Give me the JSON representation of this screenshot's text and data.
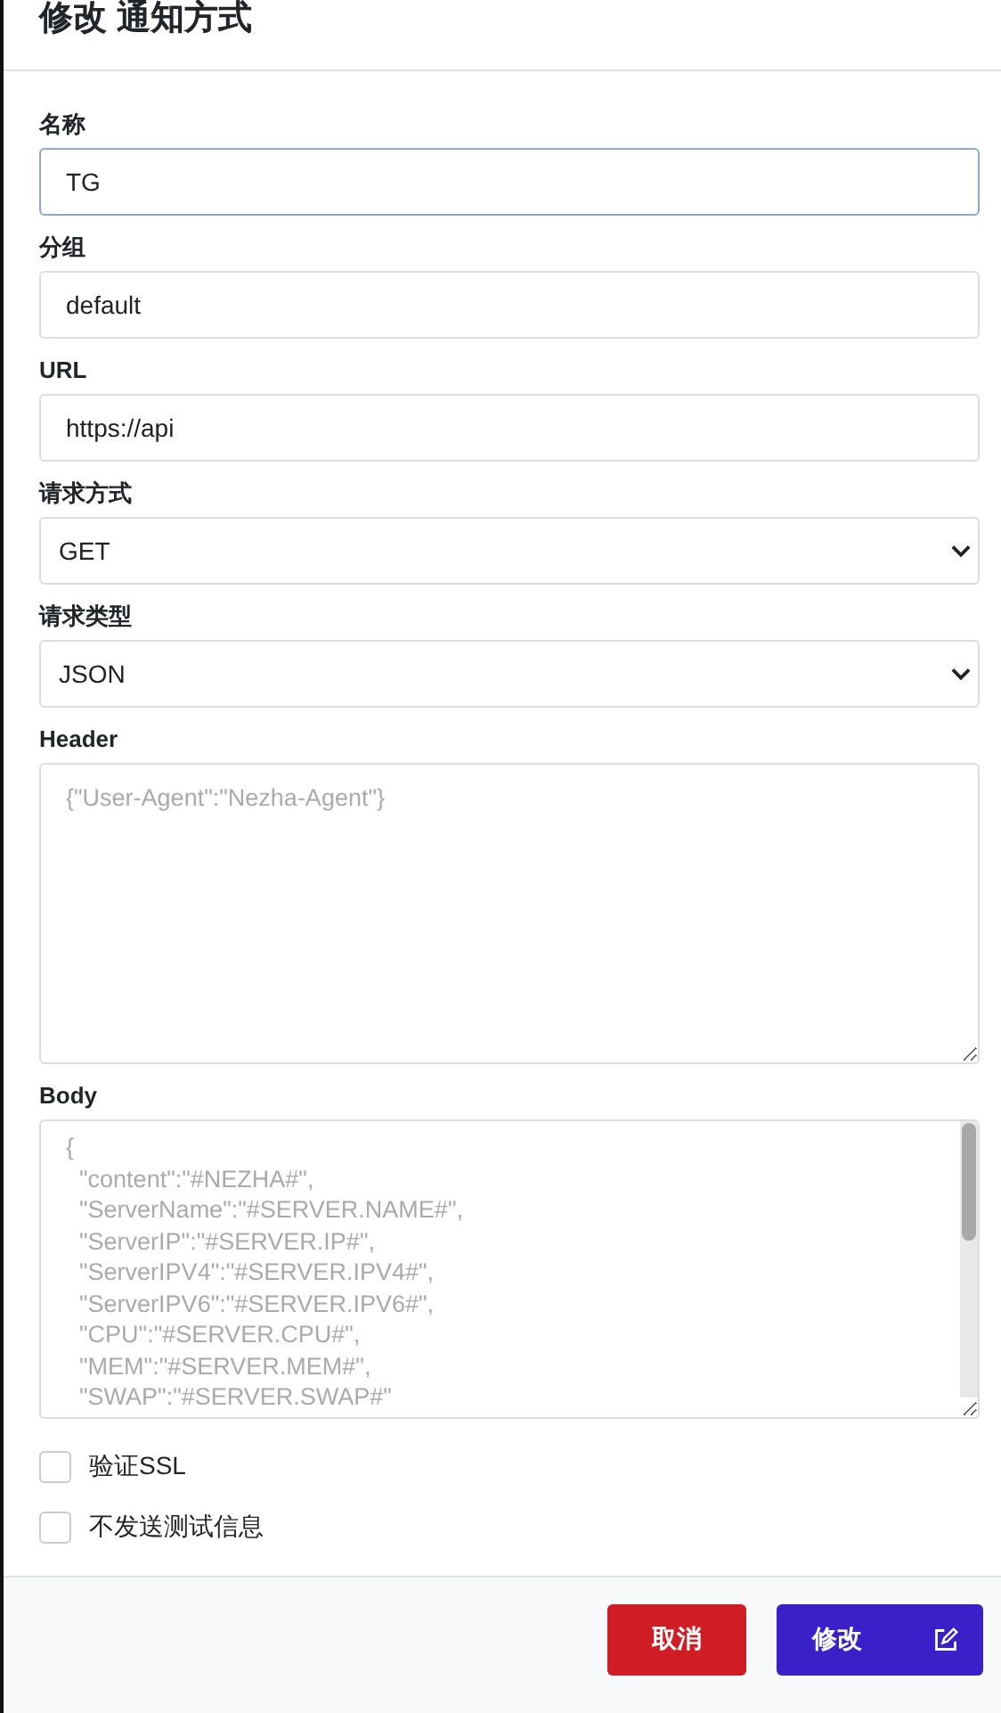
{
  "dialog": {
    "title": "修改 通知方式"
  },
  "fields": [
    {
      "kind": "input",
      "label": "名称",
      "value": "TG",
      "focused": true
    },
    {
      "kind": "input",
      "label": "分组",
      "value": "default",
      "focused": false
    },
    {
      "kind": "input",
      "label": "URL",
      "value": "https://api",
      "focused": false
    },
    {
      "kind": "select",
      "label": "请求方式",
      "value": "GET"
    },
    {
      "kind": "select",
      "label": "请求类型",
      "value": "JSON"
    },
    {
      "kind": "textarea",
      "label": "Header",
      "placeholder": "{\"User-Agent\":\"Nezha-Agent\"}",
      "scrollbar": false
    },
    {
      "kind": "textarea",
      "label": "Body",
      "placeholder": "{\n  \"content\":\"#NEZHA#\",\n  \"ServerName\":\"#SERVER.NAME#\",\n  \"ServerIP\":\"#SERVER.IP#\",\n  \"ServerIPV4\":\"#SERVER.IPV4#\",\n  \"ServerIPV6\":\"#SERVER.IPV6#\",\n  \"CPU\":\"#SERVER.CPU#\",\n  \"MEM\":\"#SERVER.MEM#\",\n  \"SWAP\":\"#SERVER.SWAP#\"",
      "scrollbar": true
    }
  ],
  "checkboxes": [
    {
      "label": "验证SSL",
      "checked": false
    },
    {
      "label": "不发送测试信息",
      "checked": false
    }
  ],
  "buttons": [
    {
      "kind": "cancel",
      "label": "取消"
    },
    {
      "kind": "submit",
      "label": "修改"
    }
  ]
}
